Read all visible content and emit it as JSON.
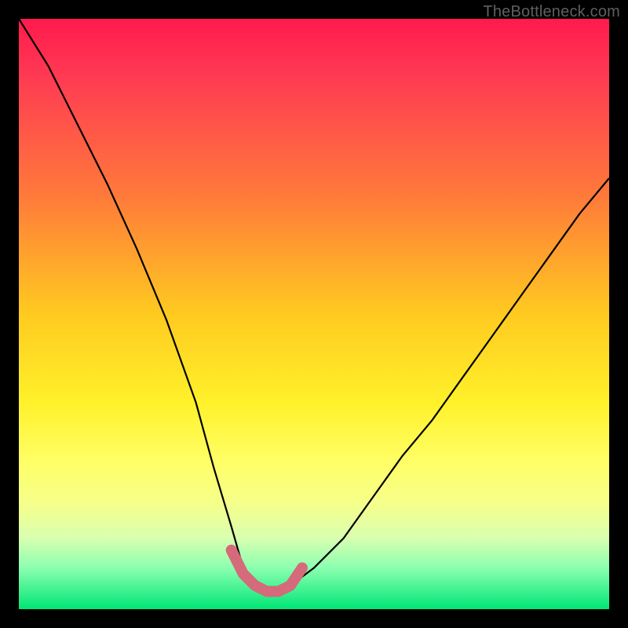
{
  "watermark": "TheBottleneck.com",
  "chart_data": {
    "type": "line",
    "title": "",
    "xlabel": "",
    "ylabel": "",
    "xlim": [
      0,
      100
    ],
    "ylim": [
      0,
      100
    ],
    "series": [
      {
        "name": "bottleneck-curve",
        "x": [
          0,
          5,
          10,
          15,
          20,
          25,
          30,
          33,
          36,
          38,
          40,
          42,
          44,
          46,
          50,
          55,
          60,
          65,
          70,
          75,
          80,
          85,
          90,
          95,
          100
        ],
        "y": [
          100,
          92,
          82,
          72,
          61,
          49,
          35,
          24,
          14,
          7,
          4,
          3,
          3,
          4,
          7,
          12,
          19,
          26,
          32,
          39,
          46,
          53,
          60,
          67,
          73
        ]
      }
    ],
    "highlight": {
      "name": "optimal-range",
      "x": [
        36,
        38,
        40,
        42,
        44,
        46,
        48
      ],
      "y": [
        10,
        6,
        4,
        3,
        3,
        4,
        7
      ],
      "color": "#d46a7a"
    }
  }
}
